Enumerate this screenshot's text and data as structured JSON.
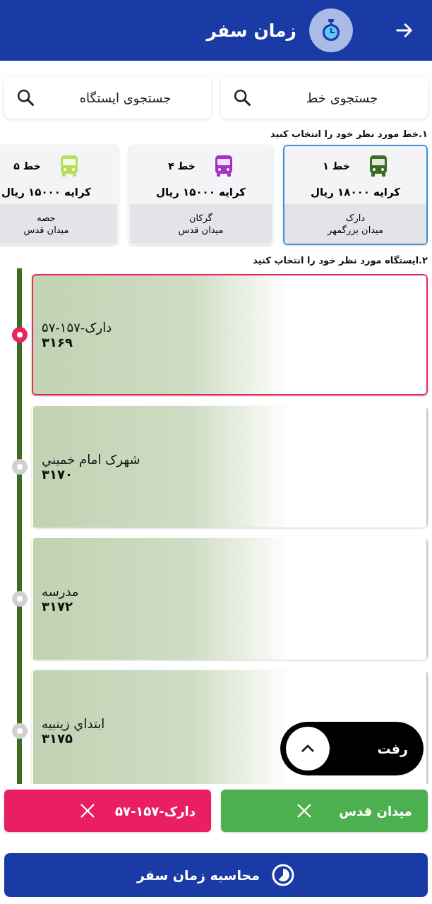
{
  "header": {
    "title": "زمان سفر"
  },
  "search": [
    {
      "placeholder": "جستجوی خط"
    },
    {
      "placeholder": "جستجوی ایستگاه"
    }
  ],
  "lines_heading": "۱.خط مورد نظر خود را انتخاب کنید",
  "lines": [
    {
      "name": "خط ۱",
      "color": "#3d6b1f",
      "fare": "کرایه ۱۸۰۰۰ ریال",
      "from": "دارک",
      "to": "میدان بزرگمهر",
      "selected": true
    },
    {
      "name": "خط ۴",
      "color": "#a62fc4",
      "fare": "کرایه ۱۵۰۰۰ ریال",
      "from": "گرکان",
      "to": "میدان قدس",
      "selected": false
    },
    {
      "name": "خط ۵",
      "color": "#b5e05a",
      "fare": "کرایه ۱۵۰۰۰ ریال",
      "from": "حصه",
      "to": "میدان قدس",
      "selected": false
    }
  ],
  "stations_heading": "۲.ایستگاه مورد نظر خود را انتخاب کنید",
  "stations": [
    {
      "name": "دارک-۱۵۷-۵۷",
      "code": "۳۱۶۹",
      "selected": true
    },
    {
      "name": "شهرک امام خميني",
      "code": "۳۱۷۰",
      "selected": false
    },
    {
      "name": "مدرسه",
      "code": "۳۱۷۲",
      "selected": false
    },
    {
      "name": "ابتداي زينبيه",
      "code": "۳۱۷۵",
      "selected": false
    }
  ],
  "direction_toggle": {
    "label": "رفت"
  },
  "chips": [
    {
      "label": "میدان قدس",
      "kind": "origin"
    },
    {
      "label": "دارک-۱۵۷-۵۷",
      "kind": "destination"
    }
  ],
  "calculate_button": "محاسبه زمان سفر"
}
